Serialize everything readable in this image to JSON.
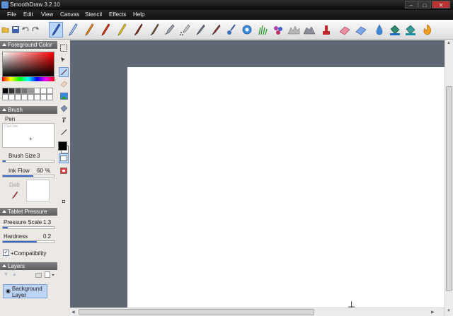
{
  "titlebar": {
    "title": "SmoothDraw 3.2.10"
  },
  "menu": [
    "File",
    "Edit",
    "View",
    "Canvas",
    "Stencil",
    "Effects",
    "Help"
  ],
  "toolbar": {
    "tools": [
      "pen",
      "pencil",
      "marker",
      "crayon",
      "brush",
      "oil-brush",
      "airbrush",
      "spray",
      "ink-pen",
      "watercolor",
      "soft-brush",
      "grass",
      "flower",
      "chalk",
      "rock",
      "stamp",
      "eraser",
      "soft-eraser",
      "blur",
      "bucket",
      "smudge",
      "fire"
    ]
  },
  "panels": {
    "foreground": {
      "title": "Foreground Color"
    },
    "brush": {
      "title": "Brush",
      "name": "Pen",
      "preview_hint": "Click me",
      "size_label": "Brush Size",
      "size_value": "3",
      "size_fraction": 0.05,
      "flow_label": "Ink Flow",
      "flow_value": "60",
      "flow_unit": "%",
      "flow_fraction": 0.6,
      "dab_label": "Dab"
    },
    "tablet": {
      "title": "Tablet Pressure",
      "pressure_label": "Pressure Scale",
      "pressure_value": "1.3",
      "pressure_fraction": 0.1,
      "hardness_label": "Hardness",
      "hardness_value": "0.2",
      "hardness_fraction": 0.67,
      "compat_label": "+Compatibility",
      "compat_checked": true
    },
    "layers": {
      "title": "Layers",
      "items": [
        {
          "name": "Background Layer"
        }
      ]
    }
  },
  "colors": {
    "accent": "#3b6bcd",
    "workspace": "#5f6774",
    "panel_header": "#6b6b6b"
  },
  "swatches": [
    "#000000",
    "#333333",
    "#555555",
    "#777777",
    "#999999",
    "#ffffff",
    "#ffffff",
    "#ffffff",
    "#ffffff",
    "#ffffff",
    "#ffffff",
    "#ffffff",
    "#ffffff",
    "#ffffff",
    "#ffffff",
    "#ffffff"
  ]
}
